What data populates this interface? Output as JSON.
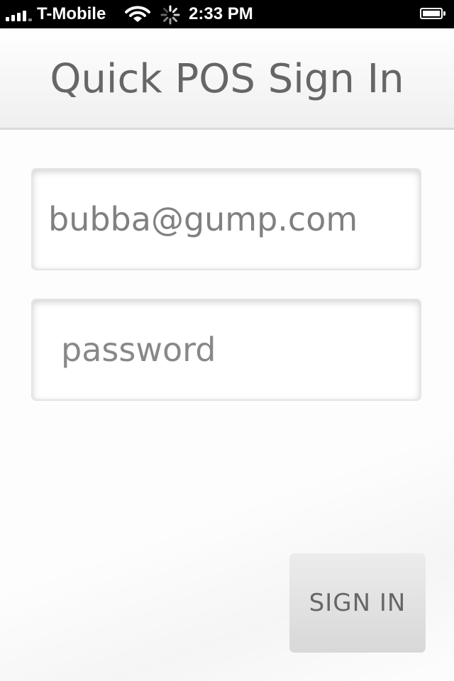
{
  "status_bar": {
    "carrier": "T-Mobile",
    "time": "2:33 PM",
    "signal_icon": "cellular-signal-icon",
    "wifi_icon": "wifi-icon",
    "activity_icon": "activity-spinner-icon",
    "battery_icon": "battery-icon"
  },
  "header": {
    "title": "Quick POS Sign In"
  },
  "form": {
    "email_value": "bubba@gump.com",
    "password_placeholder": "password",
    "signin_label": "SIGN IN"
  },
  "colors": {
    "status_bar_bg": "#000000",
    "title_text": "#666666",
    "field_text": "#808080",
    "button_bg": "#e0e0e0"
  }
}
